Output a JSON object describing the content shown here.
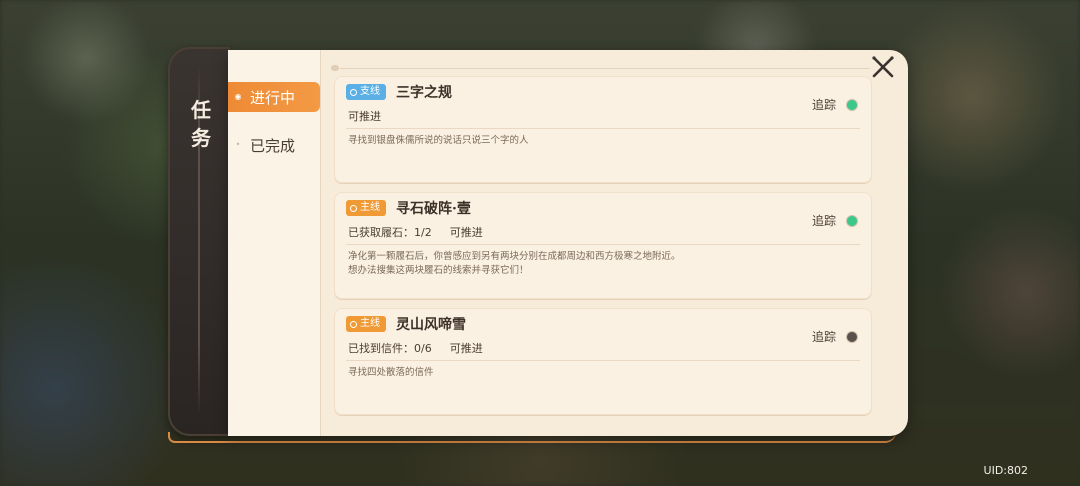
{
  "panel": {
    "title": "任务",
    "tabs": [
      {
        "label": "进行中",
        "active": true
      },
      {
        "label": "已完成",
        "active": false
      }
    ]
  },
  "quests": [
    {
      "type_label": "支线",
      "type_color": "#5ab0e4",
      "title": "三字之规",
      "status": "可推进",
      "progress": "",
      "description": "寻找到银盘侏儒所说的说话只说三个字的人",
      "track_label": "追踪",
      "tracking_color": "#3cc88a"
    },
    {
      "type_label": "主线",
      "type_color": "#ef9a34",
      "title": "寻石破阵·壹",
      "progress": "已获取履石：1/2",
      "status": "可推进",
      "description": "净化第一颗履石后，你曾感应到另有两块分别在成都周边和西方极寒之地附近。\n想办法搜集这两块履石的线索并寻获它们！",
      "track_label": "追踪",
      "tracking_color": "#3cc88a"
    },
    {
      "type_label": "主线",
      "type_color": "#ef9a34",
      "title": "灵山风啼雪",
      "progress": "已找到信件：0/6",
      "status": "可推进",
      "description": "寻找四处散落的信件",
      "track_label": "追踪",
      "tracking_color": "#5a514a"
    }
  ],
  "footer": {
    "uid": "UID:802"
  },
  "colors": {
    "accent": "#ef9a34",
    "panel_bg": "#f7ecd9"
  }
}
